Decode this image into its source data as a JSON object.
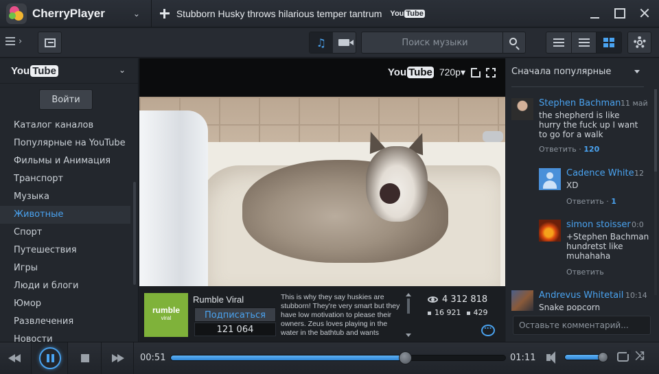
{
  "app": {
    "name": "CherryPlayer",
    "now_playing_title": "Stubborn Husky throws hilarious temper tantrum",
    "source_badge": {
      "you": "You",
      "tube": "Tube"
    }
  },
  "toolbar": {
    "search_placeholder": "Поиск музыки",
    "music_icon": "♫",
    "view_mode_active": "grid"
  },
  "sidebar": {
    "source_logo": {
      "you": "You",
      "tube": "Tube"
    },
    "login_label": "Войти",
    "categories": [
      {
        "label": "Каталог каналов",
        "active": false
      },
      {
        "label": "Популярные на YouTube",
        "active": false
      },
      {
        "label": "Фильмы и Анимация",
        "active": false
      },
      {
        "label": "Транспорт",
        "active": false
      },
      {
        "label": "Музыка",
        "active": false
      },
      {
        "label": "Животные",
        "active": true
      },
      {
        "label": "Спорт",
        "active": false
      },
      {
        "label": "Путешествия",
        "active": false
      },
      {
        "label": "Игры",
        "active": false
      },
      {
        "label": "Люди и блоги",
        "active": false
      },
      {
        "label": "Юмор",
        "active": false
      },
      {
        "label": "Развлечения",
        "active": false
      },
      {
        "label": "Новости",
        "active": false
      }
    ]
  },
  "video": {
    "overlay_logo": {
      "you": "You",
      "tube": "Tube"
    },
    "quality": "720p▾",
    "channel_logo_text": {
      "main": "rumble",
      "sub": "viral"
    },
    "channel_name": "Rumble Viral",
    "subscribe_label": "Подписаться",
    "subscriber_count": "121 064",
    "description": "This is why they say huskies are stubborn! They're very smart but they have low motivation to please their owners. Zeus loves playing in the water in the bathtub and wants",
    "views": "4 312 818",
    "likes": "16 921",
    "dislikes": "429"
  },
  "comments": {
    "sort_label": "Сначала популярные",
    "items": [
      {
        "author": "Stephen Bachman",
        "time": "11 май",
        "text": "the shepherd is like hurry the fuck up I want to go for a walk",
        "reply_label": "Ответить",
        "reply_count": "120"
      },
      {
        "author": "Cadence White",
        "time": "12",
        "text": "XD",
        "reply_label": "Ответить",
        "reply_count": "1"
      },
      {
        "author": "simon stoisser",
        "time": "0:0",
        "text": "+Stephen Bachman hundretst like muhahaha",
        "reply_label": "Ответить",
        "reply_count": ""
      },
      {
        "author": "Andrevus Whitetail",
        "time": "10:14",
        "text": "Snake popcorn",
        "reply_label": "",
        "reply_count": ""
      }
    ],
    "input_placeholder": "Оставьте комментарий..."
  },
  "player": {
    "current_time": "00:51",
    "total_time": "01:11",
    "progress": 0.7,
    "volume": 0.95,
    "shuffle_icon": "⤨"
  }
}
